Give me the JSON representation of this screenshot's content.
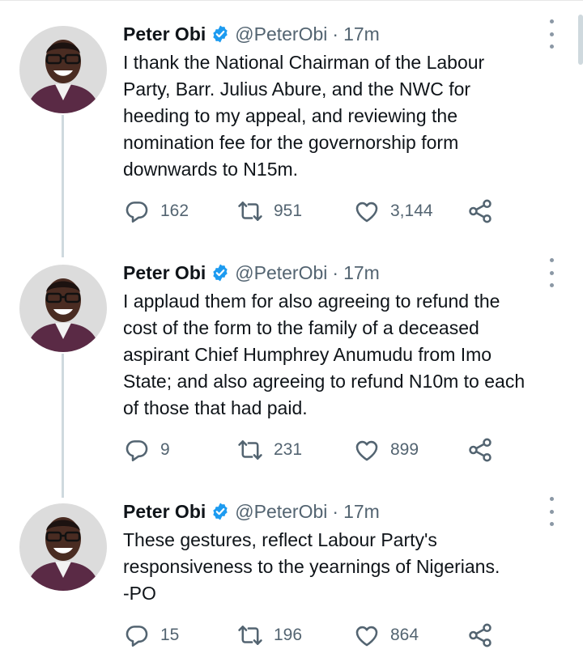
{
  "tweets": [
    {
      "name": "Peter Obi",
      "handle": "@PeterObi",
      "separator": "·",
      "time": "17m",
      "text": "I thank the National Chairman of the Labour\nParty, Barr. Julius Abure, and the NWC for\nheeding to my appeal, and reviewing the\nnomination fee for the governorship form\ndownwards to N15m.",
      "replies": "162",
      "retweets": "951",
      "likes": "3,144"
    },
    {
      "name": "Peter Obi",
      "handle": "@PeterObi",
      "separator": "·",
      "time": "17m",
      "text": "I applaud them for also agreeing to refund the\ncost of the form to the family of a deceased\naspirant Chief Humphrey Anumudu from Imo\nState; and also agreeing to refund N10m to each\nof those that had paid.",
      "replies": "9",
      "retweets": "231",
      "likes": "899"
    },
    {
      "name": "Peter Obi",
      "handle": "@PeterObi",
      "separator": "·",
      "time": "17m",
      "text": "These gestures, reflect Labour Party's\nresponsiveness  to the yearnings of Nigerians.\n-PO",
      "replies": "15",
      "retweets": "196",
      "likes": "864"
    }
  ],
  "icons": {
    "reply": "reply-icon",
    "retweet": "retweet-icon",
    "like": "like-icon",
    "share": "share-icon",
    "verified": "verified-badge-icon",
    "more": "more-options-icon"
  },
  "colors": {
    "verified": "#1d9bf0",
    "secondary_text": "#536471",
    "thread_line": "#cfd9de"
  }
}
